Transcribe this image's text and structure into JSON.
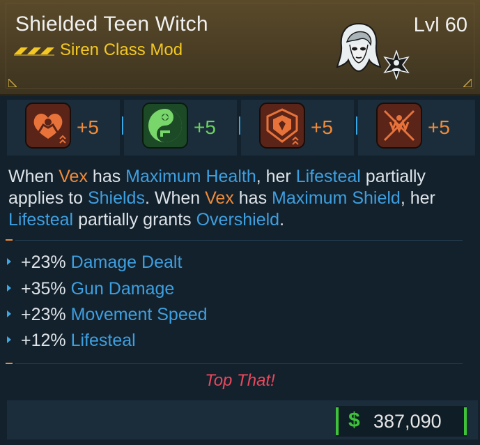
{
  "item": {
    "name": "Shielded Teen Witch",
    "level": "Lvl 60",
    "type": "Siren Class Mod",
    "rarity_icon": "rarity-chevrons-icon",
    "portrait_icon": "vex-portrait-icon",
    "class_icon": "siren-class-badge-icon"
  },
  "skills": [
    {
      "icon": "health-heart-skill-icon",
      "bonus": "+5",
      "color": "#f08b3a"
    },
    {
      "icon": "yin-yang-gun-skill-icon",
      "bonus": "+5",
      "color": "#6ad25d"
    },
    {
      "icon": "shield-emblem-skill-icon",
      "bonus": "+5",
      "color": "#f08b3a"
    },
    {
      "icon": "crossed-claws-skill-icon",
      "bonus": "+5",
      "color": "#f08b3a"
    }
  ],
  "description": {
    "p1": "When ",
    "k1": "Vex",
    "p2": " has ",
    "k2": "Maximum Health",
    "p3": ", her ",
    "k3": "Lifesteal",
    "p4": " partially applies to ",
    "k4": "Shields",
    "p5": ". When ",
    "k5": "Vex",
    "p6": " has ",
    "k6": "Maximum Shield",
    "p7": ", her ",
    "k7": "Lifesteal",
    "p8": " partially grants ",
    "k8": "Overshield",
    "p9": "."
  },
  "stats": [
    {
      "value": "+23%",
      "name": "Damage Dealt"
    },
    {
      "value": "+35%",
      "name": "Gun Damage"
    },
    {
      "value": "+23%",
      "name": "Movement Speed"
    },
    {
      "value": "+12%",
      "name": "Lifesteal"
    }
  ],
  "flavor_text": "Top That!",
  "price": {
    "icon": "$",
    "value": "387,090"
  },
  "colors": {
    "header": "#4a3d24",
    "rarity_gold": "#f3c823",
    "keyword_orange": "#f08b3a",
    "keyword_blue": "#3e9fe0",
    "flavor_red": "#e8485c",
    "money_green": "#3ec23a"
  }
}
